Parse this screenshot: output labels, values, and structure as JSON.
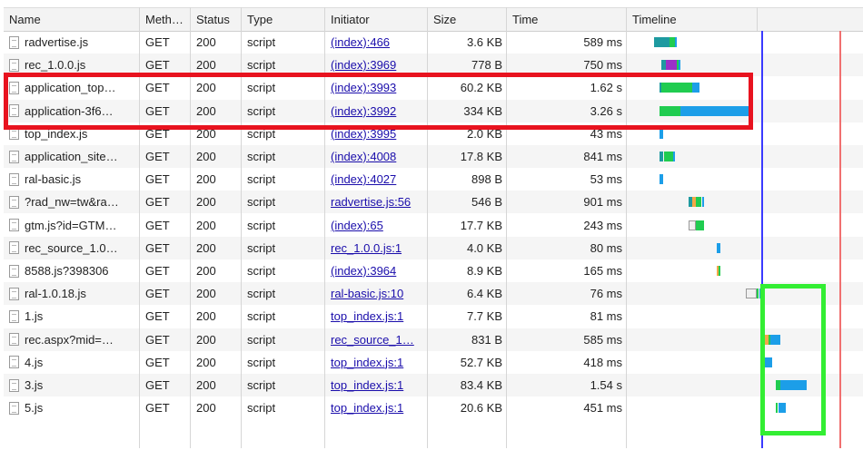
{
  "columns": [
    "Name",
    "Meth…",
    "Status",
    "Type",
    "Initiator",
    "Size",
    "Time",
    "Timeline"
  ],
  "rows": [
    {
      "name": "radvertise.js",
      "method": "GET",
      "status": "200",
      "type": "script",
      "initiator": "(index):466",
      "size": "3.6 KB",
      "time": "589 ms"
    },
    {
      "name": "rec_1.0.0.js",
      "method": "GET",
      "status": "200",
      "type": "script",
      "initiator": "(index):3969",
      "size": "778 B",
      "time": "750 ms"
    },
    {
      "name": "application_top…",
      "method": "GET",
      "status": "200",
      "type": "script",
      "initiator": "(index):3993",
      "size": "60.2 KB",
      "time": "1.62 s"
    },
    {
      "name": "application-3f6…",
      "method": "GET",
      "status": "200",
      "type": "script",
      "initiator": "(index):3992",
      "size": "334 KB",
      "time": "3.26 s"
    },
    {
      "name": "top_index.js",
      "method": "GET",
      "status": "200",
      "type": "script",
      "initiator": "(index):3995",
      "size": "2.0 KB",
      "time": "43 ms"
    },
    {
      "name": "application_site…",
      "method": "GET",
      "status": "200",
      "type": "script",
      "initiator": "(index):4008",
      "size": "17.8 KB",
      "time": "841 ms"
    },
    {
      "name": "ral-basic.js",
      "method": "GET",
      "status": "200",
      "type": "script",
      "initiator": "(index):4027",
      "size": "898 B",
      "time": "53 ms"
    },
    {
      "name": "?rad_nw=tw&ra…",
      "method": "GET",
      "status": "200",
      "type": "script",
      "initiator": "radvertise.js:56",
      "size": "546 B",
      "time": "901 ms"
    },
    {
      "name": "gtm.js?id=GTM…",
      "method": "GET",
      "status": "200",
      "type": "script",
      "initiator": "(index):65",
      "size": "17.7 KB",
      "time": "243 ms"
    },
    {
      "name": "rec_source_1.0…",
      "method": "GET",
      "status": "200",
      "type": "script",
      "initiator": "rec_1.0.0.js:1",
      "size": "4.0 KB",
      "time": "80 ms"
    },
    {
      "name": "8588.js?398306",
      "method": "GET",
      "status": "200",
      "type": "script",
      "initiator": "(index):3964",
      "size": "8.9 KB",
      "time": "165 ms"
    },
    {
      "name": "ral-1.0.18.js",
      "method": "GET",
      "status": "200",
      "type": "script",
      "initiator": "ral-basic.js:10",
      "size": "6.4 KB",
      "time": "76 ms"
    },
    {
      "name": "1.js",
      "method": "GET",
      "status": "200",
      "type": "script",
      "initiator": "top_index.js:1",
      "size": "7.7 KB",
      "time": "81 ms"
    },
    {
      "name": "rec.aspx?mid=…",
      "method": "GET",
      "status": "200",
      "type": "script",
      "initiator": "rec_source_1…",
      "size": "831 B",
      "time": "585 ms"
    },
    {
      "name": "4.js",
      "method": "GET",
      "status": "200",
      "type": "script",
      "initiator": "top_index.js:1",
      "size": "52.7 KB",
      "time": "418 ms"
    },
    {
      "name": "3.js",
      "method": "GET",
      "status": "200",
      "type": "script",
      "initiator": "top_index.js:1",
      "size": "83.4 KB",
      "time": "1.54 s"
    },
    {
      "name": "5.js",
      "method": "GET",
      "status": "200",
      "type": "script",
      "initiator": "top_index.js:1",
      "size": "20.6 KB",
      "time": "451 ms"
    }
  ],
  "colors": {
    "queue": "#f0f0f0",
    "stalled": "#1e9aa0",
    "dns": "#f3a847",
    "connect": "#9b30c8",
    "waiting": "#20cc50",
    "download": "#1c9ee8",
    "dom_line": "#3a3aff",
    "load_line": "#f07070",
    "highlight_red": "#e8131f",
    "highlight_green": "#33ee33"
  },
  "timeline_segments": [
    [
      {
        "kind": "stalled",
        "start": 0,
        "end": 0.04
      },
      {
        "kind": "waiting",
        "start": 0.04,
        "end": 0.055
      },
      {
        "kind": "download",
        "start": 0.055,
        "end": 0.06
      }
    ],
    [
      {
        "kind": "stalled",
        "start": 0.02,
        "end": 0.03
      },
      {
        "kind": "connect",
        "start": 0.03,
        "end": 0.06
      },
      {
        "kind": "waiting",
        "start": 0.06,
        "end": 0.065
      },
      {
        "kind": "download",
        "start": 0.065,
        "end": 0.07
      }
    ],
    [
      {
        "kind": "stalled",
        "start": 0.015,
        "end": 0.02
      },
      {
        "kind": "waiting",
        "start": 0.02,
        "end": 0.1
      },
      {
        "kind": "download",
        "start": 0.1,
        "end": 0.12
      }
    ],
    [
      {
        "kind": "waiting",
        "start": 0.015,
        "end": 0.07
      },
      {
        "kind": "download",
        "start": 0.07,
        "end": 0.25
      }
    ],
    [
      {
        "kind": "download",
        "start": 0.015,
        "end": 0.024
      }
    ],
    [
      {
        "kind": "stalled",
        "start": 0.015,
        "end": 0.025
      },
      {
        "kind": "waiting",
        "start": 0.025,
        "end": 0.05
      },
      {
        "kind": "download",
        "start": 0.05,
        "end": 0.055
      }
    ],
    [
      {
        "kind": "download",
        "start": 0.015,
        "end": 0.024
      }
    ],
    [
      {
        "kind": "stalled",
        "start": 0.09,
        "end": 0.1
      },
      {
        "kind": "dns",
        "start": 0.1,
        "end": 0.11
      },
      {
        "kind": "waiting",
        "start": 0.11,
        "end": 0.125
      },
      {
        "kind": "download",
        "start": 0.125,
        "end": 0.13
      }
    ],
    [
      {
        "kind": "queue",
        "start": 0.09,
        "end": 0.11
      },
      {
        "kind": "waiting",
        "start": 0.11,
        "end": 0.13
      }
    ],
    [
      {
        "kind": "download",
        "start": 0.165,
        "end": 0.175
      }
    ],
    [
      {
        "kind": "dns",
        "start": 0.165,
        "end": 0.17
      },
      {
        "kind": "waiting",
        "start": 0.17,
        "end": 0.175
      }
    ],
    [
      {
        "kind": "queue",
        "start": 0.24,
        "end": 0.27
      },
      {
        "kind": "waiting",
        "start": 0.27,
        "end": 0.275
      },
      {
        "kind": "download",
        "start": 0.275,
        "end": 0.28
      }
    ],
    [
      {
        "kind": "stalled",
        "start": 0.285,
        "end": 0.29
      }
    ],
    [
      {
        "kind": "dns",
        "start": 0.29,
        "end": 0.3
      },
      {
        "kind": "waiting",
        "start": 0.3,
        "end": 0.305
      },
      {
        "kind": "download",
        "start": 0.305,
        "end": 0.33
      }
    ],
    [
      {
        "kind": "download",
        "start": 0.29,
        "end": 0.31
      }
    ],
    [
      {
        "kind": "waiting",
        "start": 0.32,
        "end": 0.33
      },
      {
        "kind": "download",
        "start": 0.33,
        "end": 0.4
      }
    ],
    [
      {
        "kind": "waiting",
        "start": 0.32,
        "end": 0.325
      },
      {
        "kind": "download",
        "start": 0.325,
        "end": 0.345
      }
    ]
  ],
  "markers": {
    "dom_content_loaded": 0.28,
    "load": 0.485
  }
}
